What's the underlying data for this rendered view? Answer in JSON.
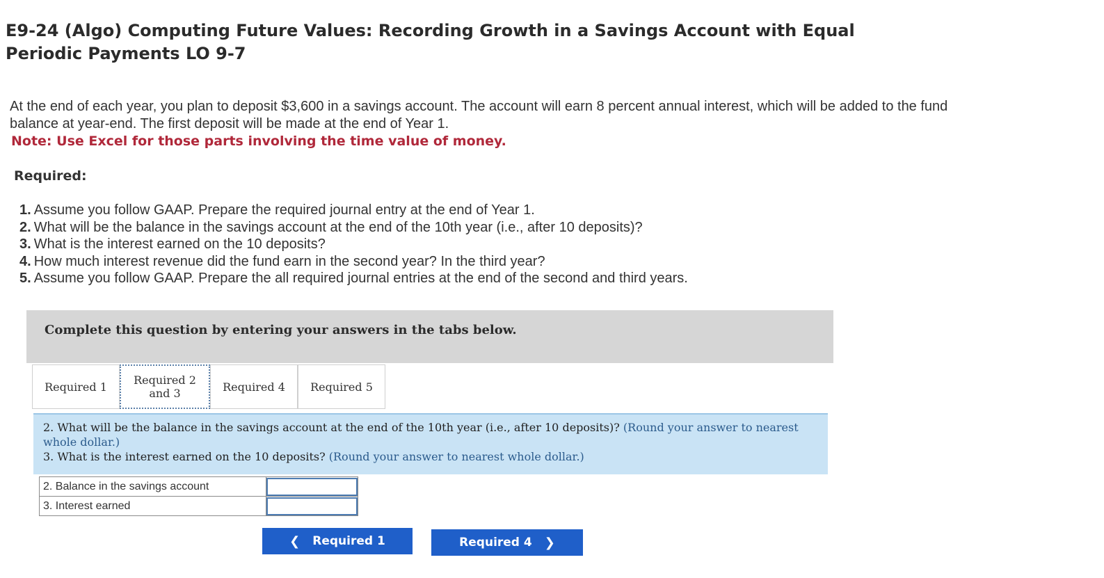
{
  "title": "E9-24 (Algo) Computing Future Values: Recording Growth in a Savings Account with Equal Periodic Payments LO 9-7",
  "intro": "At the end of each year, you plan to deposit $3,600 in a savings account. The account will earn 8 percent annual interest, which will be added to the fund balance at year-end. The first deposit will be made at the end of Year 1.",
  "note": "Note: Use Excel for those parts involving the time value of money.",
  "required_heading": "Required:",
  "requirements": [
    {
      "num": "1.",
      "text": "Assume you follow GAAP. Prepare the required journal entry at the end of Year 1."
    },
    {
      "num": "2.",
      "text": "What will be the balance in the savings account at the end of the 10th year (i.e., after 10 deposits)?"
    },
    {
      "num": "3.",
      "text": "What is the interest earned on the 10 deposits?"
    },
    {
      "num": "4.",
      "text": "How much interest revenue did the fund earn in the second year? In the third year?"
    },
    {
      "num": "5.",
      "text": "Assume you follow GAAP. Prepare the all required journal entries at the end of the second and third years."
    }
  ],
  "banner": "Complete this question by entering your answers in the tabs below.",
  "tabs": {
    "t1": "Required 1",
    "t23_line1": "Required 2",
    "t23_line2": "and 3",
    "t4": "Required 4",
    "t5": "Required 5"
  },
  "question_panel": {
    "q2": "2. What will be the balance in the savings account at the end of the 10th year (i.e., after 10 deposits)?",
    "q2_hint": "(Round your answer to nearest whole dollar.)",
    "q3": "3. What is the interest earned on the 10 deposits?",
    "q3_hint": "(Round your answer to nearest whole dollar.)"
  },
  "answers": {
    "row1_label": "2. Balance in the savings account",
    "row1_value": "",
    "row2_label": "3. Interest earned",
    "row2_value": ""
  },
  "nav": {
    "prev_label": "Required 1",
    "next_label": "Required 4"
  },
  "icons": {
    "prev": "chevron-left-icon",
    "next": "chevron-right-icon"
  }
}
